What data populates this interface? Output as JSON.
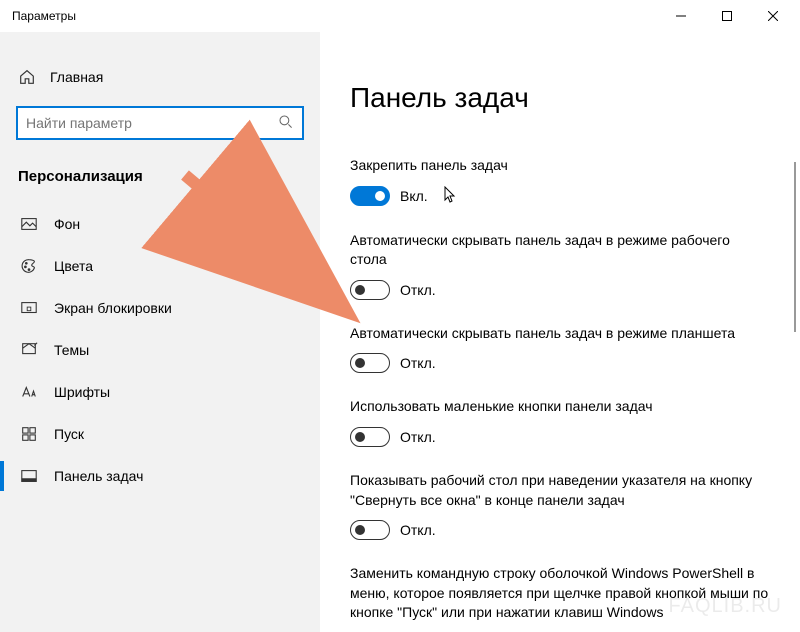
{
  "window": {
    "title": "Параметры"
  },
  "sidebar": {
    "home": "Главная",
    "search_placeholder": "Найти параметр",
    "section": "Персонализация",
    "items": [
      {
        "label": "Фон"
      },
      {
        "label": "Цвета"
      },
      {
        "label": "Экран блокировки"
      },
      {
        "label": "Темы"
      },
      {
        "label": "Шрифты"
      },
      {
        "label": "Пуск"
      },
      {
        "label": "Панель задач"
      }
    ]
  },
  "main": {
    "title": "Панель задач",
    "settings": [
      {
        "label": "Закрепить панель задач",
        "state": "Вкл.",
        "on": true
      },
      {
        "label": "Автоматически скрывать панель задач в режиме рабочего стола",
        "state": "Откл.",
        "on": false
      },
      {
        "label": "Автоматически скрывать панель задач в режиме планшета",
        "state": "Откл.",
        "on": false
      },
      {
        "label": "Использовать маленькие кнопки панели задач",
        "state": "Откл.",
        "on": false
      },
      {
        "label": "Показывать рабочий стол при наведении указателя на кнопку \"Свернуть все окна\" в конце панели задач",
        "state": "Откл.",
        "on": false
      },
      {
        "label": "Заменить командную строку оболочкой Windows PowerShell в меню, которое появляется при щелчке правой кнопкой мыши по кнопке \"Пуск\" или при нажатии клавиш Windows"
      }
    ]
  },
  "watermark": "FAQLIB.RU"
}
